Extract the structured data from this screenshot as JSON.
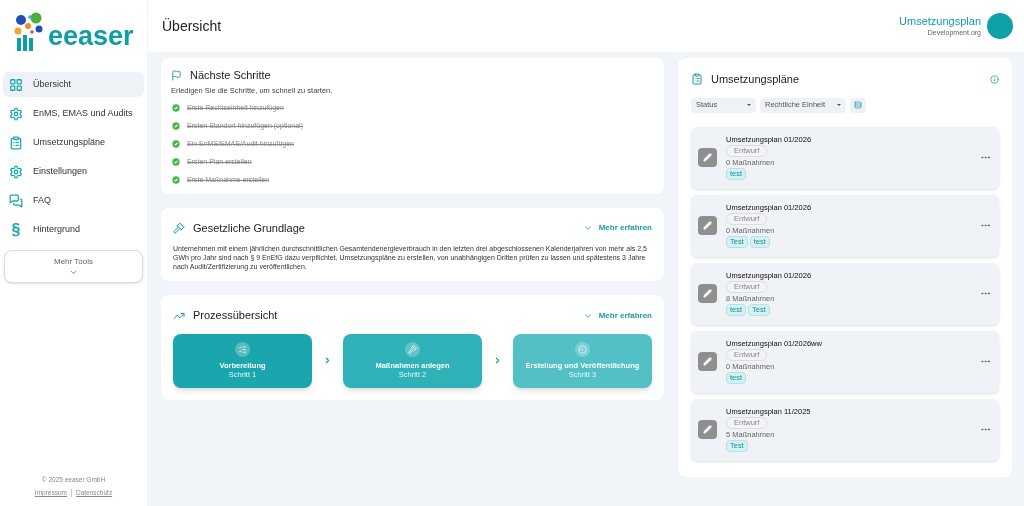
{
  "logo": {
    "text": "eeaser"
  },
  "sidebar": {
    "items": [
      {
        "label": "Übersicht",
        "selected": true
      },
      {
        "label": "EnMS, EMAS und Audits",
        "selected": false
      },
      {
        "label": "Umsetzungspläne",
        "selected": false
      },
      {
        "label": "Einstellungen",
        "selected": false
      },
      {
        "label": "FAQ",
        "selected": false
      },
      {
        "label": "Hintergrund",
        "glyph": "§",
        "selected": false
      }
    ],
    "more_tools": "Mehr Tools",
    "footer": {
      "copyright": "© 2025 eeaser GmbH",
      "links": [
        "Impressum",
        "Datenschutz"
      ]
    }
  },
  "header": {
    "title": "Übersicht",
    "plan_title": "Umsetzungsplan",
    "org": "Development.org"
  },
  "next_steps": {
    "title": "Nächste Schritte",
    "subtitle": "Erledigen Sie die Schritte, um schnell zu starten.",
    "steps": [
      {
        "label": "Erste Rechtseinheit hinzufügen",
        "done": true
      },
      {
        "label": "Ersten Standort hinzufügen (optional)",
        "done": true
      },
      {
        "label": "Ein EnMS/EMAS/Audit hinzufügen",
        "done": true
      },
      {
        "label": "Ersten Plan erstellen",
        "done": true
      },
      {
        "label": "Erste Maßnahme erstellen",
        "done": true
      }
    ]
  },
  "legal": {
    "title": "Gesetzliche Grundlage",
    "more": "Mehr erfahren",
    "text": "Unternehmen mit einem jährlichen durchschnittlichen Gesamtendenergieverbrauch in den letzten drei abgeschlossenen Kalenderjahren von mehr als 2,5 GWh pro Jahr sind nach § 9 EnEfG dazu verpflichtet, Umsetzungspläne zu erstellen, von unabhängigen Dritten prüfen zu lassen und spätestens 3 Jahre nach Audit/Zertifizierung zu veröffentlichen."
  },
  "process": {
    "title": "Prozessübersicht",
    "more": "Mehr erfahren",
    "steps": [
      {
        "title": "Vorbereitung",
        "step": "Schritt 1"
      },
      {
        "title": "Maßnahmen anlegen",
        "step": "Schritt 2"
      },
      {
        "title": "Erstellung und Veröffentlichung",
        "step": "Schritt 3"
      }
    ]
  },
  "plans": {
    "title": "Umsetzungspläne",
    "filters": [
      "Status",
      "Rechtliche Einheit"
    ],
    "items": [
      {
        "title": "Umsetzungsplan 01/2026",
        "status": "Entwurf",
        "count": "0 Maßnahmen",
        "tags": [
          "test"
        ]
      },
      {
        "title": "Umsetzungsplan 01/2026",
        "status": "Entwurf",
        "count": "0 Maßnahmen",
        "tags": [
          "Test",
          "test"
        ]
      },
      {
        "title": "Umsetzungsplan 01/2026",
        "status": "Entwurf",
        "count": "8 Maßnahmen",
        "tags": [
          "test",
          "Test"
        ]
      },
      {
        "title": "Umsetzungsplan 01/2026ww",
        "status": "Entwurf",
        "count": "0 Maßnahmen",
        "tags": [
          "test"
        ]
      },
      {
        "title": "Umsetzungsplan 11/2025",
        "status": "Entwurf",
        "count": "5 Maßnahmen",
        "tags": [
          "Test"
        ]
      }
    ]
  }
}
